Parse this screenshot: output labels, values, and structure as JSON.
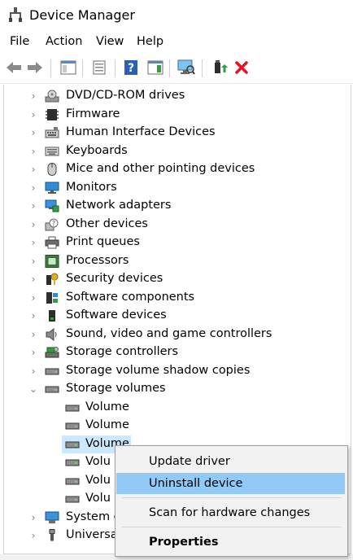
{
  "window": {
    "title": "Device Manager"
  },
  "menu": [
    "File",
    "Action",
    "View",
    "Help"
  ],
  "tree": [
    {
      "label": "DVD/CD-ROM drives",
      "icon": "dvd-drive-icon"
    },
    {
      "label": "Firmware",
      "icon": "firmware-chip-icon"
    },
    {
      "label": "Human Interface Devices",
      "icon": "hid-keyboard-icon"
    },
    {
      "label": "Keyboards",
      "icon": "keyboard-icon"
    },
    {
      "label": "Mice and other pointing devices",
      "icon": "mouse-icon"
    },
    {
      "label": "Monitors",
      "icon": "monitor-icon"
    },
    {
      "label": "Network adapters",
      "icon": "network-adapter-icon"
    },
    {
      "label": "Other devices",
      "icon": "unknown-device-icon"
    },
    {
      "label": "Print queues",
      "icon": "printer-icon"
    },
    {
      "label": "Processors",
      "icon": "processor-icon"
    },
    {
      "label": "Security devices",
      "icon": "security-key-icon"
    },
    {
      "label": "Software components",
      "icon": "software-component-icon"
    },
    {
      "label": "Software devices",
      "icon": "software-device-icon"
    },
    {
      "label": "Sound, video and game controllers",
      "icon": "speaker-icon"
    },
    {
      "label": "Storage controllers",
      "icon": "storage-controller-icon"
    },
    {
      "label": "Storage volume shadow copies",
      "icon": "shadow-copy-drive-icon"
    },
    {
      "label": "Storage volumes",
      "icon": "drive-icon",
      "expanded": true
    },
    {
      "label": "Volume",
      "icon": "volume-icon",
      "child": true
    },
    {
      "label": "Volume",
      "icon": "volume-icon",
      "child": true
    },
    {
      "label": "Volume",
      "icon": "volume-icon",
      "child": true,
      "selected": true
    },
    {
      "label": "Volu",
      "icon": "volume-icon",
      "child": true
    },
    {
      "label": "Volu",
      "icon": "volume-icon",
      "child": true
    },
    {
      "label": "Volu",
      "icon": "volume-icon",
      "child": true
    },
    {
      "label": "System d",
      "icon": "system-device-icon"
    },
    {
      "label": "Universal",
      "icon": "usb-icon"
    }
  ],
  "context_menu": {
    "update": "Update driver",
    "uninstall": "Uninstall device",
    "scan": "Scan for hardware changes",
    "properties": "Properties"
  },
  "colors": {
    "selection": "#cce8ff",
    "menu_highlight": "#91c9f7",
    "uninstall_red": "#e81123"
  }
}
